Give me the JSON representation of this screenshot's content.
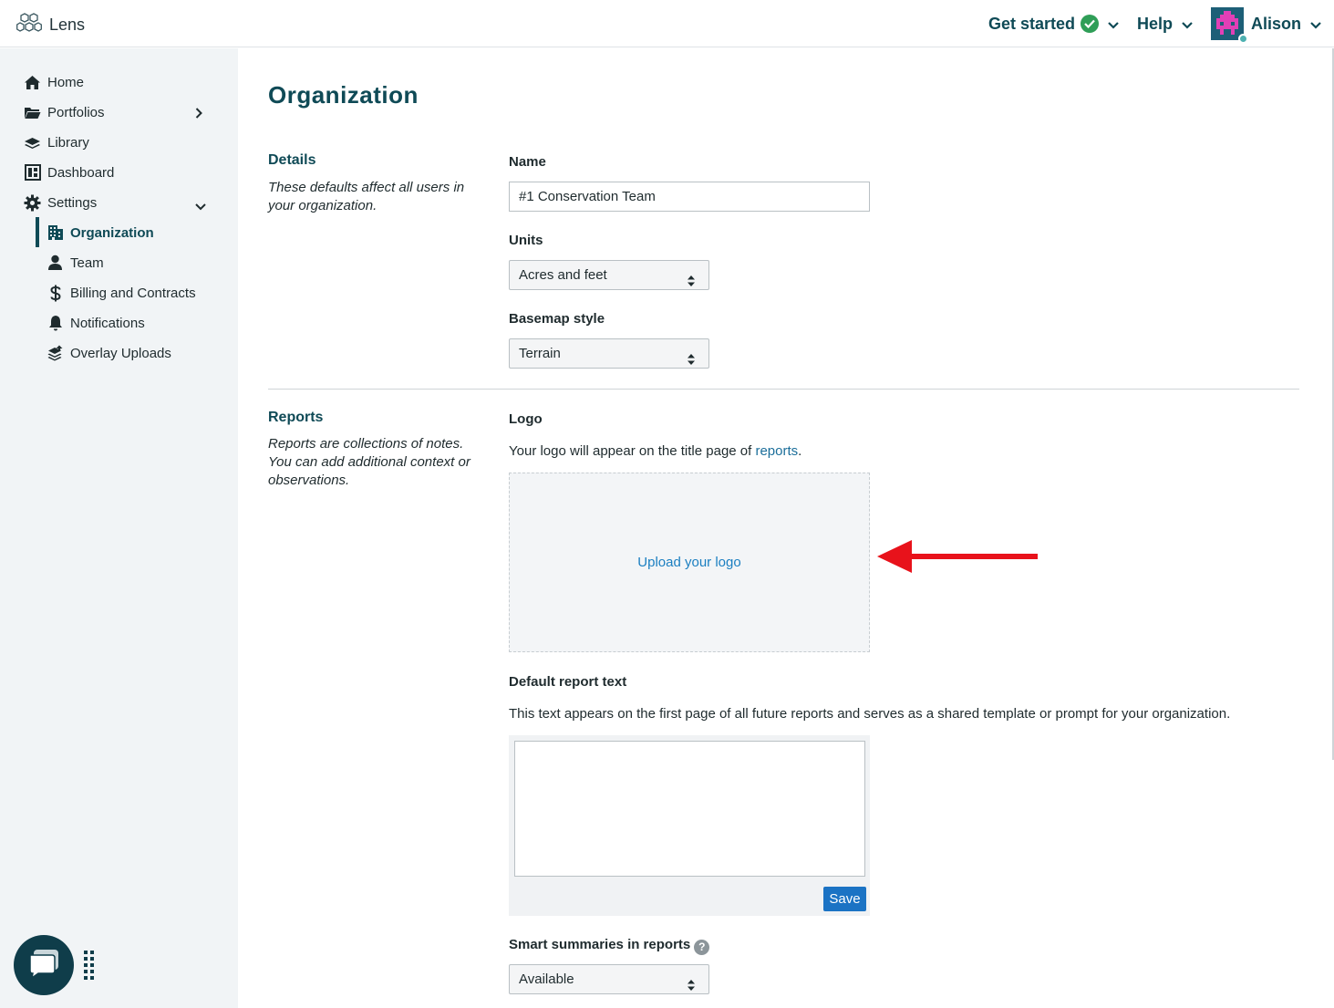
{
  "app": {
    "name": "Lens"
  },
  "header": {
    "get_started": "Get started",
    "help": "Help",
    "user": "Alison"
  },
  "sidebar": {
    "items": [
      {
        "label": "Home",
        "icon": "home-icon"
      },
      {
        "label": "Portfolios",
        "icon": "folder-icon"
      },
      {
        "label": "Library",
        "icon": "layers-icon"
      },
      {
        "label": "Dashboard",
        "icon": "dashboard-icon"
      },
      {
        "label": "Settings",
        "icon": "gear-icon"
      }
    ],
    "settings_items": [
      {
        "label": "Organization",
        "icon": "building-icon",
        "active": true
      },
      {
        "label": "Team",
        "icon": "user-icon"
      },
      {
        "label": "Billing and Contracts",
        "icon": "dollar-icon"
      },
      {
        "label": "Notifications",
        "icon": "bell-icon"
      },
      {
        "label": "Overlay Uploads",
        "icon": "stack-upload-icon"
      }
    ]
  },
  "page": {
    "title": "Organization",
    "details": {
      "title": "Details",
      "description": "These defaults affect all users in your organization.",
      "name_label": "Name",
      "name_value": "#1 Conservation Team",
      "units_label": "Units",
      "units_value": "Acres and feet",
      "basemap_label": "Basemap style",
      "basemap_value": "Terrain"
    },
    "reports": {
      "title": "Reports",
      "description": "Reports are collections of notes. You can add additional context or observations.",
      "logo_label": "Logo",
      "logo_text_before": "Your logo will appear on the title page of ",
      "logo_text_link": "reports",
      "logo_text_after": ".",
      "upload_label": "Upload your logo",
      "default_text_label": "Default report text",
      "default_text_desc": "This text appears on the first page of all future reports and serves as a shared template or prompt for your organization.",
      "default_text_value": "",
      "save_label": "Save",
      "smart_label": "Smart summaries in reports",
      "smart_help": "?",
      "smart_value": "Available"
    }
  },
  "colors": {
    "brand_dark": "#0f4a56",
    "link": "#1b6e9a",
    "primary_button": "#1b73c4",
    "success": "#2f9e57",
    "annotation_arrow": "#e8121b"
  }
}
